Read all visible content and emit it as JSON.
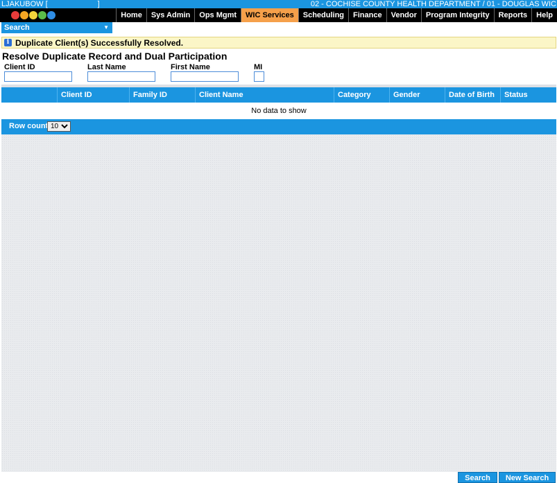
{
  "header": {
    "user": "LJAKUBOW [",
    "user_suffix": "]",
    "org": "02 - COCHISE COUNTY HEALTH DEPARTMENT / 01 - DOUGLAS WIC"
  },
  "nav": {
    "items": [
      "Home",
      "Sys Admin",
      "Ops Mgmt",
      "WIC Services",
      "Scheduling",
      "Finance",
      "Vendor",
      "Program Integrity",
      "Reports",
      "Help"
    ],
    "active": "WIC Services"
  },
  "search_menu": {
    "label": "Search"
  },
  "message": {
    "text": "Duplicate Client(s) Successfully Resolved."
  },
  "page": {
    "title": "Resolve Duplicate Record and Dual Participation"
  },
  "form": {
    "client_id_label": "Client ID",
    "last_name_label": "Last Name",
    "first_name_label": "First Name",
    "mi_label": "MI",
    "client_id_value": "",
    "last_name_value": "",
    "first_name_value": "",
    "mi_value": ""
  },
  "grid": {
    "columns": [
      "Client ID",
      "Family ID",
      "Client Name",
      "Category",
      "Gender",
      "Date of Birth",
      "Status"
    ],
    "no_data": "No data to show"
  },
  "pager": {
    "row_count_label": "Row count:",
    "row_count_value": "10"
  },
  "actions": {
    "search_label": "Search",
    "new_search_label": "New Search"
  },
  "colors": {
    "accent": "#1b95e0",
    "active_tab": "#f5a04a",
    "message_bg": "#fbf6c7"
  }
}
